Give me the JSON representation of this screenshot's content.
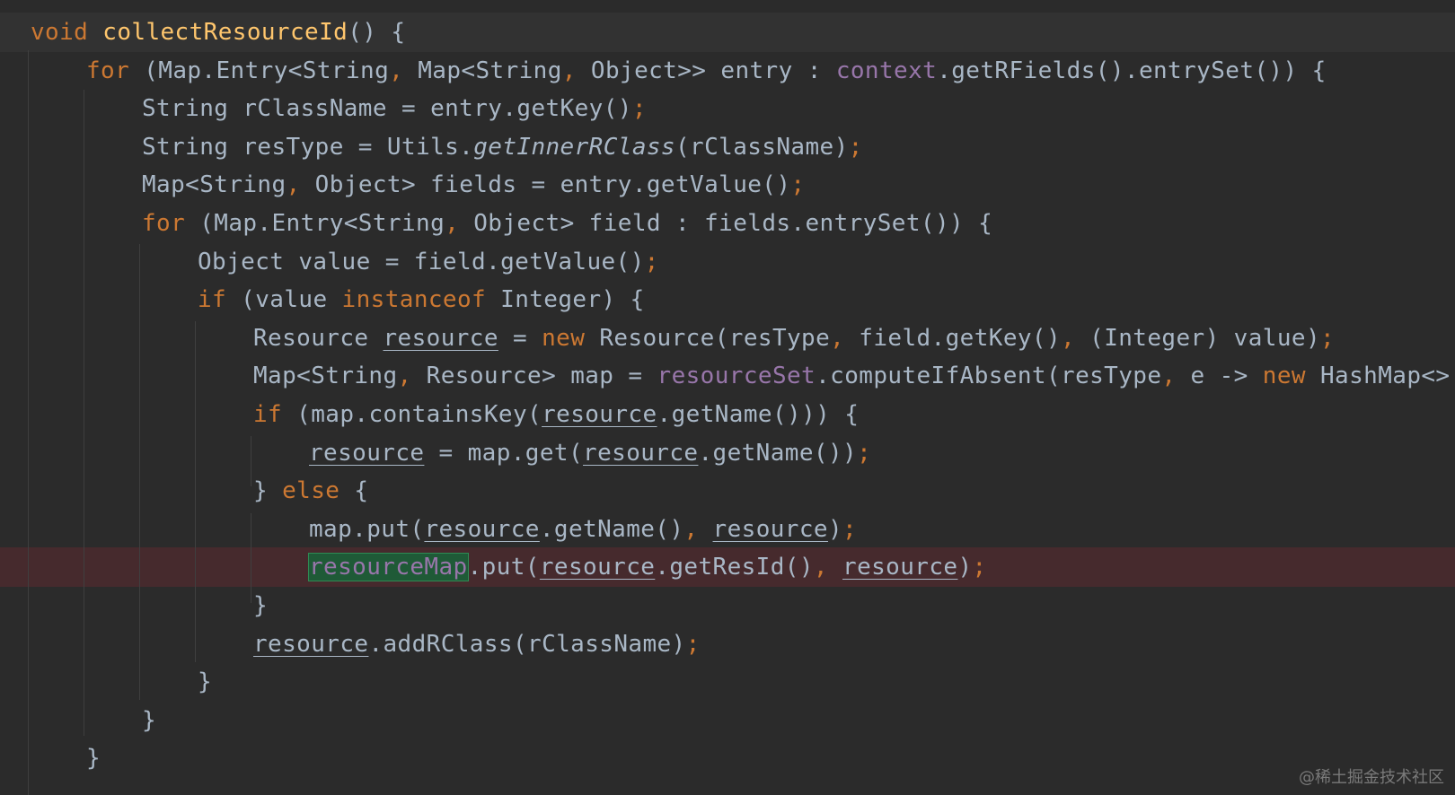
{
  "code_lines": [
    {
      "tokens": [
        [
          "void ",
          "kw"
        ],
        [
          "collectResourceId",
          "fn"
        ],
        [
          "() {",
          ""
        ]
      ]
    },
    {
      "tokens": [
        [
          "for ",
          "kw"
        ],
        [
          "(Map.Entry<String",
          ""
        ],
        [
          ", ",
          "punct"
        ],
        [
          "Map<String",
          ""
        ],
        [
          ", ",
          "punct"
        ],
        [
          "Object>> entry : ",
          ""
        ],
        [
          "context",
          "fld"
        ],
        [
          ".getRFields().entrySet()) {",
          ""
        ]
      ]
    },
    {
      "tokens": [
        [
          "String rClassName = entry.getKey()",
          ""
        ],
        [
          ";",
          "punct"
        ]
      ]
    },
    {
      "tokens": [
        [
          "String resType = Utils.",
          ""
        ],
        [
          "getInnerRClass",
          "ital"
        ],
        [
          "(rClassName)",
          ""
        ],
        [
          ";",
          "punct"
        ]
      ]
    },
    {
      "tokens": [
        [
          "Map<String",
          ""
        ],
        [
          ", ",
          "punct"
        ],
        [
          "Object> fields = entry.getValue()",
          ""
        ],
        [
          ";",
          "punct"
        ]
      ]
    },
    {
      "tokens": [
        [
          "for ",
          "kw"
        ],
        [
          "(Map.Entry<String",
          ""
        ],
        [
          ", ",
          "punct"
        ],
        [
          "Object> field : fields.entrySet()) {",
          ""
        ]
      ]
    },
    {
      "tokens": [
        [
          "Object value = field.getValue()",
          ""
        ],
        [
          ";",
          "punct"
        ]
      ]
    },
    {
      "tokens": [
        [
          "if ",
          "kw"
        ],
        [
          "(value ",
          ""
        ],
        [
          "instanceof ",
          "kw"
        ],
        [
          "Integer) {",
          ""
        ]
      ]
    },
    {
      "tokens": [
        [
          "Resource ",
          ""
        ],
        [
          "resource",
          "ul"
        ],
        [
          " = ",
          ""
        ],
        [
          "new ",
          "kw"
        ],
        [
          "Resource(resType",
          ""
        ],
        [
          ", ",
          "punct"
        ],
        [
          "field.getKey()",
          ""
        ],
        [
          ", ",
          "punct"
        ],
        [
          "(Integer) value)",
          ""
        ],
        [
          ";",
          "punct"
        ]
      ]
    },
    {
      "tokens": [
        [
          "Map<String",
          ""
        ],
        [
          ", ",
          "punct"
        ],
        [
          "Resource> map = ",
          ""
        ],
        [
          "resourceSet",
          "fld"
        ],
        [
          ".computeIfAbsent(resType",
          ""
        ],
        [
          ", ",
          "punct"
        ],
        [
          "e -> ",
          ""
        ],
        [
          "new ",
          "kw"
        ],
        [
          "HashMap<>",
          ""
        ]
      ]
    },
    {
      "tokens": [
        [
          "if ",
          "kw"
        ],
        [
          "(map.containsKey(",
          ""
        ],
        [
          "resource",
          "ul"
        ],
        [
          ".getName())) {",
          ""
        ]
      ]
    },
    {
      "tokens": [
        [
          "resource",
          "ul"
        ],
        [
          " = map.get(",
          ""
        ],
        [
          "resource",
          "ul"
        ],
        [
          ".getName())",
          ""
        ],
        [
          ";",
          "punct"
        ]
      ]
    },
    {
      "tokens": [
        [
          "} ",
          ""
        ],
        [
          "else ",
          "kw"
        ],
        [
          "{",
          ""
        ]
      ]
    },
    {
      "tokens": [
        [
          "map.put(",
          ""
        ],
        [
          "resource",
          "ul"
        ],
        [
          ".getName()",
          ""
        ],
        [
          ", ",
          "punct"
        ],
        [
          "resource",
          "ul"
        ],
        [
          ")",
          ""
        ],
        [
          ";",
          "punct"
        ]
      ]
    },
    {
      "tokens": [
        [
          "resourceMap",
          "fld hl-green"
        ],
        [
          ".put(",
          ""
        ],
        [
          "resource",
          "ul"
        ],
        [
          ".getResId()",
          ""
        ],
        [
          ", ",
          "punct"
        ],
        [
          "resource",
          "ul"
        ],
        [
          ")",
          ""
        ],
        [
          ";",
          "punct"
        ]
      ]
    },
    {
      "tokens": [
        [
          "}",
          ""
        ]
      ]
    },
    {
      "tokens": [
        [
          "resource",
          "ul"
        ],
        [
          ".addRClass(rClassName)",
          ""
        ],
        [
          ";",
          "punct"
        ]
      ]
    },
    {
      "tokens": [
        [
          "}",
          ""
        ]
      ]
    },
    {
      "tokens": [
        [
          "}",
          ""
        ]
      ]
    },
    {
      "tokens": [
        [
          "}",
          ""
        ]
      ]
    }
  ],
  "line_states": {
    "current_line": 1,
    "error_line": 15
  },
  "watermark": "@稀土掘金技术社区",
  "colors": {
    "background": "#2b2b2b",
    "text": "#a9b7c6",
    "keyword": "#cc7832",
    "method_declaration": "#ffc66d",
    "field": "#9876aa",
    "error_line": "#462a2d",
    "usage_highlight": "#1f5a37"
  }
}
